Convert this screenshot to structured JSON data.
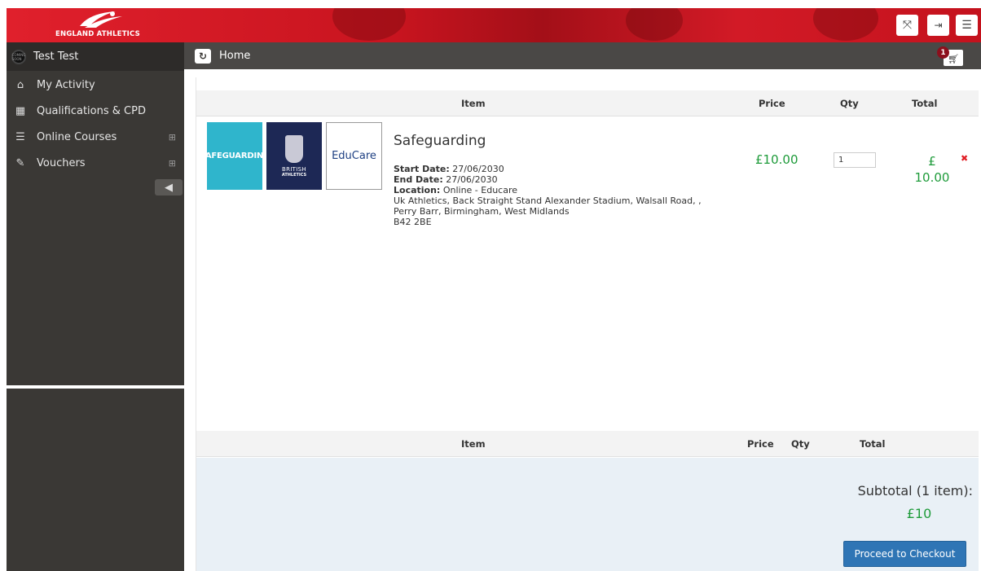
{
  "header": {
    "logo_text": "ENGLAND ATHLETICS",
    "fullscreen_icon": "expand-icon",
    "logout_icon": "logout-icon",
    "menu_icon": "hamburger-icon"
  },
  "sidebar": {
    "user_name": "Test Test",
    "avatar_text": "COMING SOON",
    "items": [
      {
        "label": "My Activity",
        "icon": "home-icon"
      },
      {
        "label": "Qualifications & CPD",
        "icon": "calendar-icon"
      },
      {
        "label": "Online Courses",
        "icon": "list-icon",
        "expand": "⊞"
      },
      {
        "label": "Vouchers",
        "icon": "ticket-icon",
        "expand": "⊞"
      }
    ],
    "collapse_icon": "arrow-left-circle-icon"
  },
  "breadcrumb": {
    "label": "Home",
    "cart_count": "1"
  },
  "cart": {
    "columns": {
      "item": "Item",
      "price": "Price",
      "qty": "Qty",
      "total": "Total"
    },
    "item": {
      "thumb1_text": "SAFEGUARDING",
      "thumb2_line1": "BRITISH",
      "thumb2_line2": "ATHLETICS",
      "thumb3_text": "EduCare",
      "title": "Safeguarding",
      "start_label": "Start Date:",
      "start_value": "27/06/2030",
      "end_label": "End Date:",
      "end_value": "27/06/2030",
      "location_label": "Location:",
      "location_value": "Online - Educare",
      "address_line1": "Uk Athletics, Back Straight Stand Alexander Stadium, Walsall Road, ,",
      "address_line2": "Perry Barr, Birmingham, West Midlands",
      "address_line3": "B42 2BE",
      "price": "£10.00",
      "qty": "1",
      "total_currency": "£",
      "total_value": "10.00",
      "remove_symbol": "✖"
    },
    "subtotal_label": "Subtotal (1 item):",
    "subtotal_value": "£10",
    "checkout_label": "Proceed to Checkout"
  },
  "colors": {
    "brand_red": "#d21a26",
    "sidebar": "#3a3835",
    "price_green": "#1e9b3a",
    "checkout_blue": "#2f75b5"
  }
}
